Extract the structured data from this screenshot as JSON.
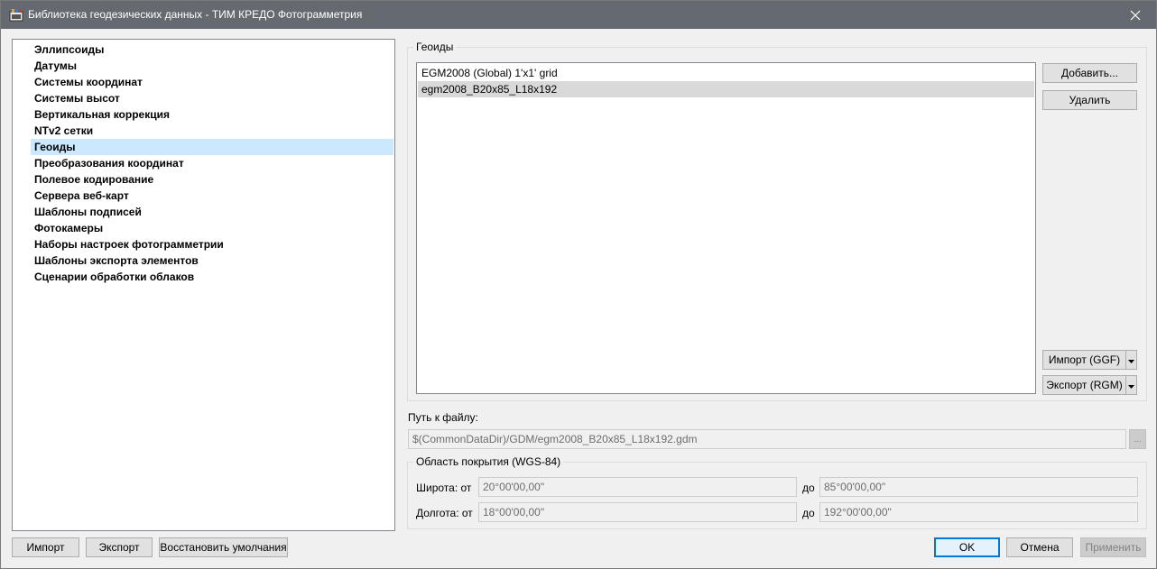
{
  "window": {
    "title": "Библиотека геодезических данных - ТИМ КРЕДО Фотограмметрия"
  },
  "nav": {
    "items": [
      {
        "label": "Эллипсоиды"
      },
      {
        "label": "Датумы"
      },
      {
        "label": "Системы координат"
      },
      {
        "label": "Системы высот"
      },
      {
        "label": "Вертикальная коррекция"
      },
      {
        "label": "NTv2 сетки"
      },
      {
        "label": "Геоиды"
      },
      {
        "label": "Преобразования координат"
      },
      {
        "label": "Полевое кодирование"
      },
      {
        "label": "Сервера веб-карт"
      },
      {
        "label": "Шаблоны подписей"
      },
      {
        "label": "Фотокамеры"
      },
      {
        "label": "Наборы настроек фотограмметрии"
      },
      {
        "label": "Шаблоны экспорта элементов"
      },
      {
        "label": "Сценарии обработки облаков"
      }
    ],
    "selected_index": 6
  },
  "bottom_left": {
    "import_label": "Импорт",
    "export_label": "Экспорт",
    "restore_label": "Восстановить умолчания"
  },
  "geoids": {
    "group_label": "Геоиды",
    "items": [
      {
        "label": "EGM2008 (Global) 1'x1' grid"
      },
      {
        "label": "egm2008_B20x85_L18x192"
      }
    ],
    "selected_index": 1,
    "add_label": "Добавить...",
    "delete_label": "Удалить",
    "import_label": "Импорт (GGF)",
    "export_label": "Экспорт (RGM)"
  },
  "file": {
    "label": "Путь к файлу:",
    "value": "$(CommonDataDir)/GDM/egm2008_B20x85_L18x192.gdm",
    "browse_label": "..."
  },
  "coverage": {
    "group_label": "Область покрытия (WGS-84)",
    "lat_label": "Широта: от",
    "lat_from": "20°00'00,00\"",
    "lat_to_label": "до",
    "lat_to": "85°00'00,00\"",
    "lon_label": "Долгота: от",
    "lon_from": "18°00'00,00\"",
    "lon_to_label": "до",
    "lon_to": "192°00'00,00\""
  },
  "dialog": {
    "ok_label": "OK",
    "cancel_label": "Отмена",
    "apply_label": "Применить"
  },
  "colors": {
    "titlebar": "#646a70",
    "selection": "#cce8ff",
    "accent": "#0078d7"
  }
}
